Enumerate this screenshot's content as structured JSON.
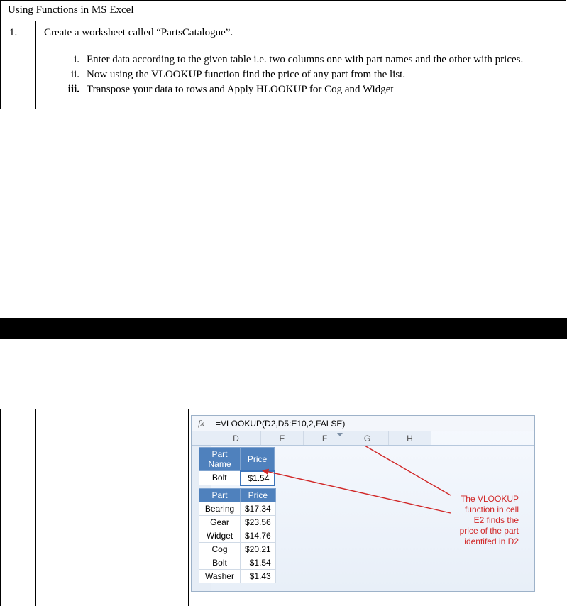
{
  "doc": {
    "title": "Using Functions in MS Excel",
    "step_number": "1.",
    "step_text": "Create a worksheet called “PartsCatalogue”.",
    "items": [
      {
        "roman": "i.",
        "text": "Enter data according to the given table i.e. two columns one with part names and the other with prices."
      },
      {
        "roman": "ii.",
        "text": "Now using the VLOOKUP function find the price of any part from the list."
      },
      {
        "roman": "iii.",
        "text": "Transpose your data to rows and Apply HLOOKUP for Cog and Widget"
      }
    ]
  },
  "excel": {
    "fx_label": "fx",
    "formula": "=VLOOKUP(D2,D5:E10,2,FALSE)",
    "columns": [
      "D",
      "E",
      "F",
      "G",
      "H"
    ],
    "lookup": {
      "headers": [
        "Part Name",
        "Price"
      ],
      "part": "Bolt",
      "price": "$1.54"
    },
    "parts": {
      "headers": [
        "Part",
        "Price"
      ],
      "rows": [
        {
          "part": "Bearing",
          "price": "$17.34"
        },
        {
          "part": "Gear",
          "price": "$23.56"
        },
        {
          "part": "Widget",
          "price": "$14.76"
        },
        {
          "part": "Cog",
          "price": "$20.21"
        },
        {
          "part": "Bolt",
          "price": "$1.54"
        },
        {
          "part": "Washer",
          "price": "$1.43"
        }
      ]
    },
    "callout": "The VLOOKUP function in cell E2 finds the price of the part identifed in D2"
  }
}
